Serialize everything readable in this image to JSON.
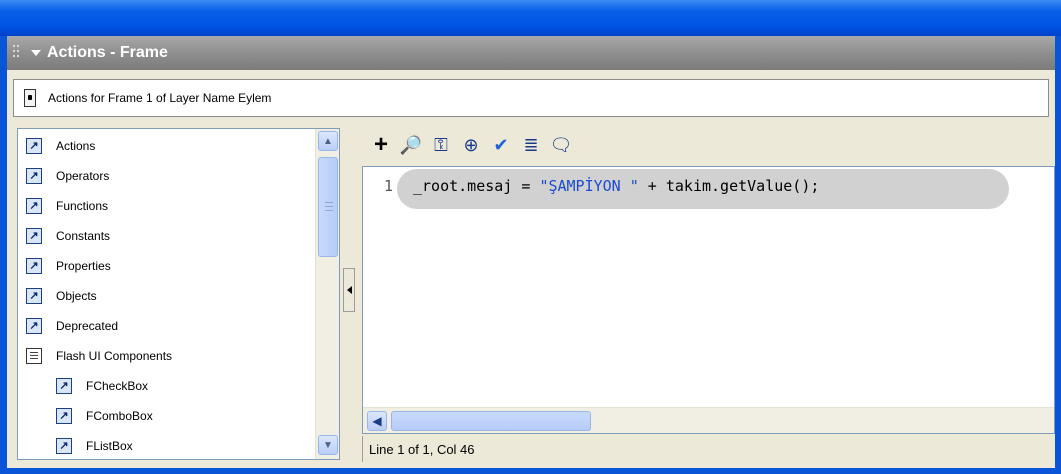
{
  "panel": {
    "title": "Actions - Frame"
  },
  "subheader": {
    "text": "Actions for Frame 1 of Layer Name Eylem"
  },
  "tree": {
    "items": [
      {
        "label": "Actions",
        "icon": "action-book-icon",
        "indent": 0
      },
      {
        "label": "Operators",
        "icon": "action-book-icon",
        "indent": 0
      },
      {
        "label": "Functions",
        "icon": "action-book-icon",
        "indent": 0
      },
      {
        "label": "Constants",
        "icon": "action-book-icon",
        "indent": 0
      },
      {
        "label": "Properties",
        "icon": "action-book-icon",
        "indent": 0
      },
      {
        "label": "Objects",
        "icon": "action-book-icon",
        "indent": 0
      },
      {
        "label": "Deprecated",
        "icon": "action-book-icon",
        "indent": 0
      },
      {
        "label": "Flash UI Components",
        "icon": "open-book-icon",
        "indent": 0
      },
      {
        "label": "FCheckBox",
        "icon": "action-book-icon",
        "indent": 1
      },
      {
        "label": "FComboBox",
        "icon": "action-book-icon",
        "indent": 1
      },
      {
        "label": "FListBox",
        "icon": "action-book-icon",
        "indent": 1
      }
    ]
  },
  "toolbar": {
    "buttons": [
      {
        "name": "add-script-button",
        "glyph": "+"
      },
      {
        "name": "find-button",
        "glyph": "🔎"
      },
      {
        "name": "replace-button",
        "glyph": "⚿"
      },
      {
        "name": "insert-target-path-button",
        "glyph": "⊕"
      },
      {
        "name": "check-syntax-button",
        "glyph": "✔"
      },
      {
        "name": "auto-format-button",
        "glyph": "≣"
      },
      {
        "name": "show-code-hint-button",
        "glyph": "🗨"
      }
    ]
  },
  "editor": {
    "line_number": "1",
    "code_prefix": "_root.mesaj = ",
    "code_string": "\"ŞAMPİYON \"",
    "code_suffix": " + takim.getValue();"
  },
  "status": {
    "text": "Line 1 of 1, Col 46"
  },
  "colors": {
    "titlebar": "#0055e5",
    "panel_header": "#8f8f8f",
    "code_string": "#1a4bd1",
    "code_highlight": "#d1d1d1"
  }
}
